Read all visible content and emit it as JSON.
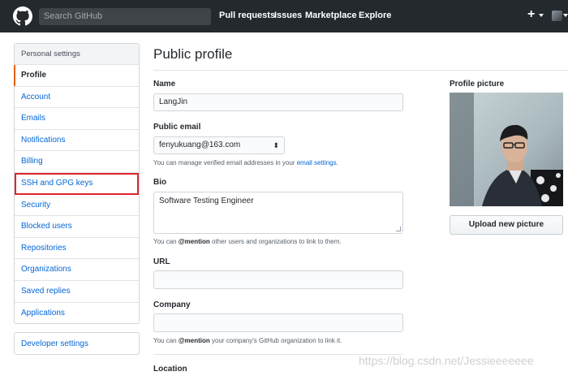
{
  "header": {
    "search_placeholder": "Search GitHub",
    "nav": [
      "Pull requests",
      "Issues",
      "Marketplace",
      "Explore"
    ],
    "plus_label": "+"
  },
  "sidebar": {
    "heading": "Personal settings",
    "items": [
      {
        "label": "Profile",
        "selected": true
      },
      {
        "label": "Account"
      },
      {
        "label": "Emails"
      },
      {
        "label": "Notifications"
      },
      {
        "label": "Billing"
      },
      {
        "label": "SSH and GPG keys",
        "highlighted": true
      },
      {
        "label": "Security"
      },
      {
        "label": "Blocked users"
      },
      {
        "label": "Repositories"
      },
      {
        "label": "Organizations"
      },
      {
        "label": "Saved replies"
      },
      {
        "label": "Applications"
      }
    ],
    "developer_settings": "Developer settings"
  },
  "main": {
    "title": "Public profile",
    "name_label": "Name",
    "name_value": "LangJin",
    "email_label": "Public email",
    "email_value": "fenyukuang@163.com",
    "email_note_prefix": "You can manage verified email addresses in your ",
    "email_note_link": "email settings",
    "email_note_suffix": ".",
    "bio_label": "Bio",
    "bio_value": "Software Testing Engineer",
    "bio_note_prefix": "You can ",
    "bio_note_mention": "@mention",
    "bio_note_suffix": " other users and organizations to link to them.",
    "url_label": "URL",
    "url_value": "",
    "company_label": "Company",
    "company_value": "",
    "company_note_prefix": "You can ",
    "company_note_mention": "@mention",
    "company_note_suffix": " your company's GitHub organization to link it.",
    "location_label": "Location"
  },
  "profile_picture": {
    "label": "Profile picture",
    "upload_label": "Upload new picture"
  },
  "watermark": "https://blog.csdn.net/Jessieeeeeee",
  "colors": {
    "header_bg": "#24292e",
    "link": "#0366d6",
    "selected_marker": "#e36209",
    "highlight_box": "#e0262b"
  }
}
